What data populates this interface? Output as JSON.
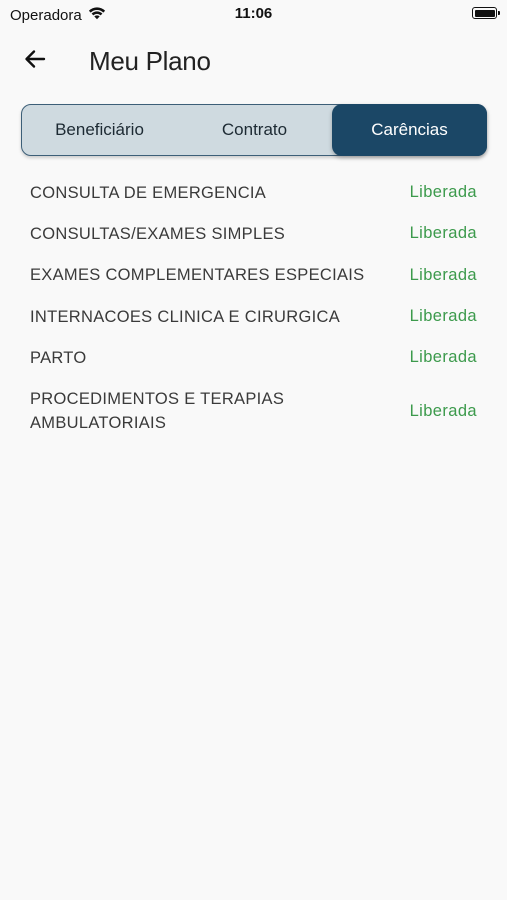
{
  "status_bar": {
    "carrier": "Operadora",
    "time": "11:06",
    "wifi_icon": "wifi-icon",
    "battery_icon": "battery-icon"
  },
  "header": {
    "back_icon": "arrow-left-icon",
    "title": "Meu Plano"
  },
  "tabs": [
    {
      "label": "Beneficiário",
      "active": false
    },
    {
      "label": "Contrato",
      "active": false
    },
    {
      "label": "Carências",
      "active": true
    }
  ],
  "colors": {
    "active_tab": "#1b4766",
    "inactive_tabs": "#cfdae0",
    "status_green": "#3c9a4c"
  },
  "carencias": [
    {
      "name": "CONSULTA DE EMERGENCIA",
      "status": "Liberada"
    },
    {
      "name": "CONSULTAS/EXAMES SIMPLES",
      "status": "Liberada"
    },
    {
      "name": "EXAMES COMPLEMENTARES ESPECIAIS",
      "status": "Liberada"
    },
    {
      "name": "INTERNACOES CLINICA E CIRURGICA",
      "status": "Liberada"
    },
    {
      "name": "PARTO",
      "status": "Liberada"
    },
    {
      "name": "PROCEDIMENTOS E TERAPIAS AMBULATORIAIS",
      "status": "Liberada"
    }
  ]
}
